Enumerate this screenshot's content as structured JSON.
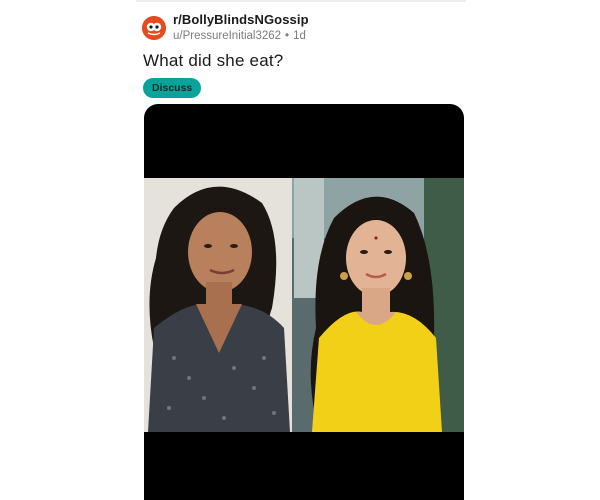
{
  "post": {
    "subreddit": "r/BollyBlindsNGossip",
    "author": "u/PressureInitial3262",
    "separator": "•",
    "age": "1d",
    "title": "What did she eat?",
    "flair": "Discuss"
  },
  "colors": {
    "flair_bg": "#0aa39a",
    "subreddit_icon_bg": "#e8491d",
    "media_bg": "#000000"
  },
  "icons": {
    "subreddit_avatar": "subreddit-avatar-icon"
  }
}
